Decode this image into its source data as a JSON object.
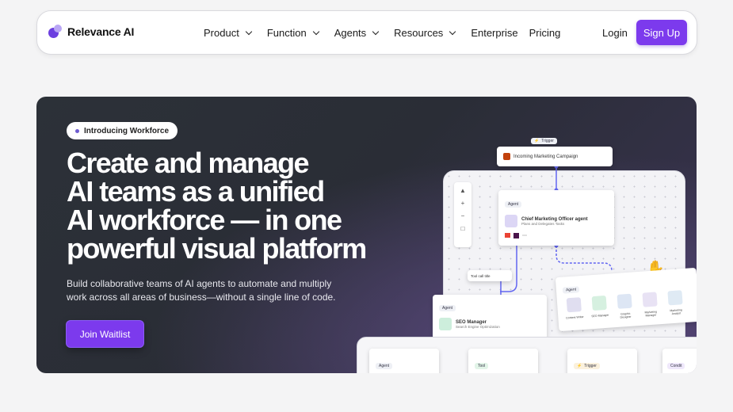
{
  "nav": {
    "logo_text": "Relevance AI",
    "menu": [
      {
        "label": "Product",
        "has_dropdown": true
      },
      {
        "label": "Function",
        "has_dropdown": true
      },
      {
        "label": "Agents",
        "has_dropdown": true
      },
      {
        "label": "Resources",
        "has_dropdown": true
      },
      {
        "label": "Enterprise",
        "has_dropdown": false
      },
      {
        "label": "Pricing",
        "has_dropdown": false
      }
    ],
    "login_label": "Login",
    "signup_label": "Sign Up"
  },
  "hero": {
    "pill_label": "Introducing Workforce",
    "headline_lines": [
      "Create and manage",
      "AI teams as a unified",
      "AI workforce — in one",
      "powerful visual platform"
    ],
    "subtext": "Build collaborative teams of AI agents to automate and multiply work across all areas of business—without a single line of code.",
    "cta_label": "Join Waitlist"
  },
  "illustration": {
    "trigger_tag": "Trigger",
    "trigger_card": "Incoming Marketing Campaign",
    "agent_tag": "Agent",
    "cmo_title": "Chief Marketing Officer agent",
    "cmo_sub": "Plans and Delegates Tasks",
    "tool_call": "Tool call title",
    "seo_title": "SEO Manager",
    "seo_sub": "Search Engine Optimization",
    "team_tag": "Agent",
    "team_members": [
      "Content Writer",
      "SEO Manager",
      "Graphic Designer",
      "Marketing Manager",
      "Marketing Analyst"
    ],
    "bottom_tags": [
      "Agent",
      "Tool",
      "Trigger",
      "Condit"
    ]
  },
  "colors": {
    "accent": "#7c3aed",
    "hero_bg": "#2c3138",
    "page_bg": "#f4f4f5"
  }
}
